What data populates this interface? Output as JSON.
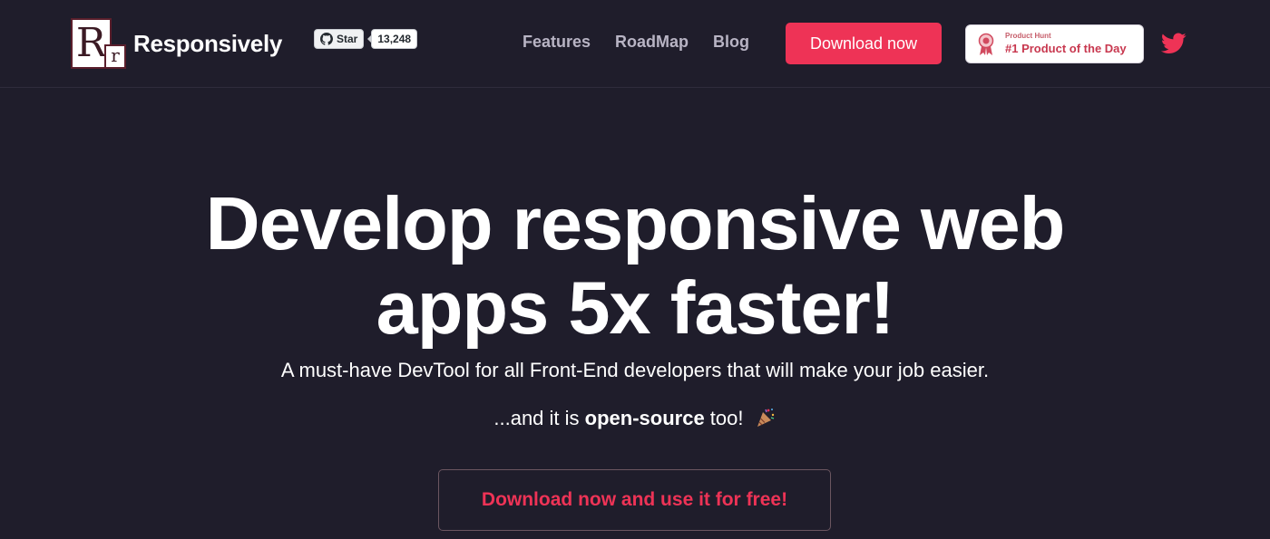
{
  "header": {
    "logo": {
      "mark_big": "R",
      "mark_small": "r",
      "brand": "Responsively"
    },
    "github": {
      "star_label": "Star",
      "star_count": "13,248",
      "icon": "github-icon"
    },
    "nav": [
      {
        "label": "Features"
      },
      {
        "label": "RoadMap"
      },
      {
        "label": "Blog"
      }
    ],
    "download_label": "Download now",
    "product_hunt": {
      "small": "Product Hunt",
      "big": "#1 Product of the Day",
      "icon": "medal-icon"
    },
    "twitter_icon": "twitter-icon"
  },
  "hero": {
    "title_line1": "Develop responsive web",
    "title_line2": "apps 5x faster!",
    "subtitle": "A must-have DevTool for all Front-End developers that will make your job easier.",
    "open_prefix": "...and it is ",
    "open_bold": "open-source",
    "open_suffix": " too!",
    "party_icon": "party-popper-icon",
    "cta_label": "Download now and use it for free!"
  },
  "colors": {
    "background": "#1f1d2b",
    "accent": "#ee3356",
    "nav_text": "#b8b4c4"
  }
}
